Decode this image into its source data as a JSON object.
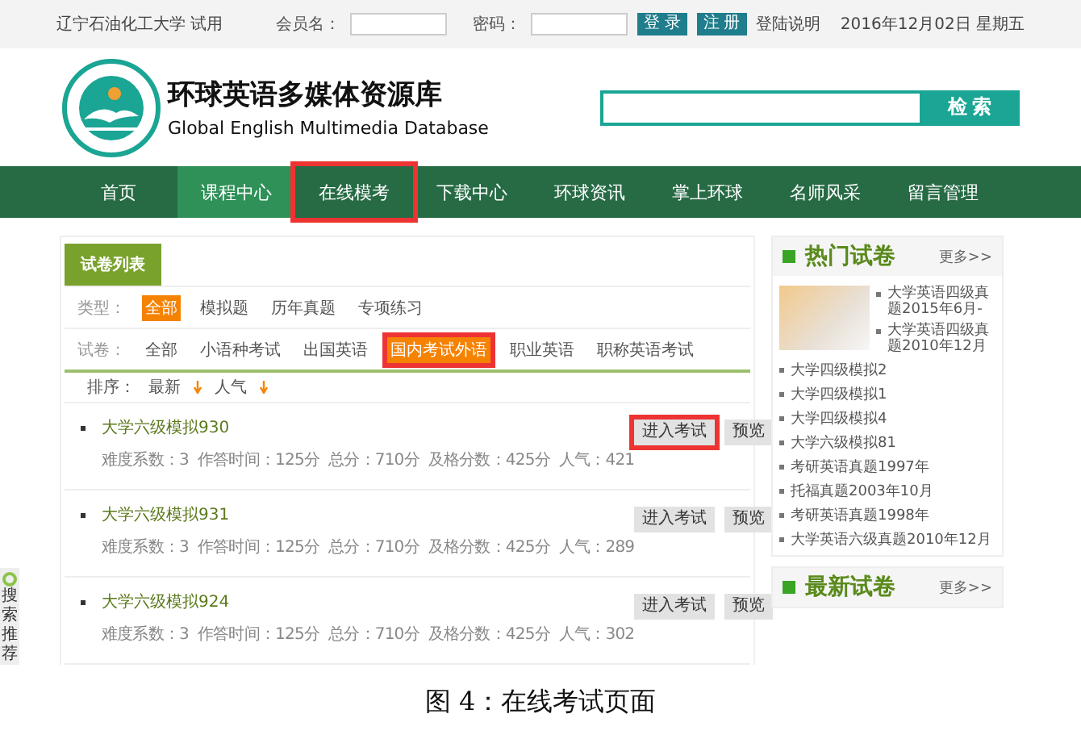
{
  "top_bar": {
    "school": "辽宁石油化工大学 试用",
    "username_label": "会员名：",
    "password_label": "密码：",
    "buttons": [
      "登 录",
      "注 册"
    ],
    "help_link": "登陆说明",
    "date": "2016年12月02日 星期五"
  },
  "header": {
    "title": "环球英语多媒体资源库",
    "subtitle": "Global English Multimedia Database",
    "search_button": "检 索"
  },
  "nav": [
    {
      "label": "首页",
      "selected": false,
      "highlighted": false
    },
    {
      "label": "课程中心",
      "selected": true,
      "highlighted": false
    },
    {
      "label": "在线模考",
      "selected": false,
      "highlighted": true
    },
    {
      "label": "下载中心",
      "selected": false,
      "highlighted": false
    },
    {
      "label": "环球资讯",
      "selected": false,
      "highlighted": false
    },
    {
      "label": "掌上环球",
      "selected": false,
      "highlighted": false
    },
    {
      "label": "名师风采",
      "selected": false,
      "highlighted": false
    },
    {
      "label": "留言管理",
      "selected": false,
      "highlighted": false
    }
  ],
  "exam_list": {
    "tab": "试卷列表",
    "type_filter": {
      "label": "类型：",
      "options": [
        {
          "label": "全部",
          "selected": true,
          "highlighted": false
        },
        {
          "label": "模拟题",
          "selected": false,
          "highlighted": false
        },
        {
          "label": "历年真题",
          "selected": false,
          "highlighted": false
        },
        {
          "label": "专项练习",
          "selected": false,
          "highlighted": false
        }
      ]
    },
    "paper_filter": {
      "label": "试卷：",
      "options": [
        {
          "label": "全部",
          "selected": false,
          "highlighted": false
        },
        {
          "label": "小语种考试",
          "selected": false,
          "highlighted": false
        },
        {
          "label": "出国英语",
          "selected": false,
          "highlighted": false
        },
        {
          "label": "国内考试外语",
          "selected": true,
          "highlighted": true
        },
        {
          "label": "职业英语",
          "selected": false,
          "highlighted": false
        },
        {
          "label": "职称英语考试",
          "selected": false,
          "highlighted": false
        }
      ]
    },
    "sort": {
      "label": "排序：",
      "options": [
        "最新",
        "人气"
      ]
    },
    "exams": [
      {
        "title": "大学六级模拟930",
        "meta": "难度系数：3  作答时间：125分  总分：710分  及格分数：425分  人气：421",
        "buttons": [
          {
            "label": "进入考试",
            "highlighted": true
          },
          {
            "label": "预览",
            "highlighted": false
          }
        ]
      },
      {
        "title": "大学六级模拟931",
        "meta": "难度系数：3  作答时间：125分  总分：710分  及格分数：425分  人气：289",
        "buttons": [
          {
            "label": "进入考试",
            "highlighted": false
          },
          {
            "label": "预览",
            "highlighted": false
          }
        ]
      },
      {
        "title": "大学六级模拟924",
        "meta": "难度系数：3  作答时间：125分  总分：710分  及格分数：425分  人气：302",
        "buttons": [
          {
            "label": "进入考试",
            "highlighted": false
          },
          {
            "label": "预览",
            "highlighted": false
          }
        ]
      }
    ]
  },
  "hot_papers": {
    "title": "热门试卷",
    "more": "更多>>",
    "featured": [
      "大学英语四级真题2015年6月-",
      "大学英语四级真题2010年12月"
    ],
    "items": [
      "大学四级模拟2",
      "大学四级模拟1",
      "大学四级模拟4",
      "大学六级模拟81",
      "考研英语真题1997年",
      "托福真题2003年10月",
      "考研英语真题1998年",
      "大学英语六级真题2010年12月"
    ]
  },
  "latest_papers": {
    "title": "最新试卷",
    "more": "更多>>"
  },
  "side_tab": "搜索推荐",
  "caption": "图 4：在线考试页面"
}
